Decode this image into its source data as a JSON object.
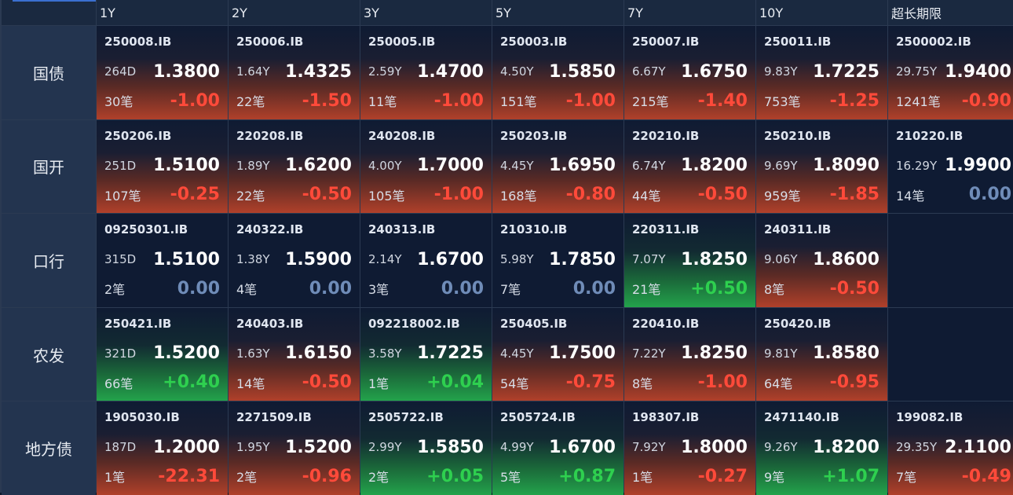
{
  "headers": [
    "1Y",
    "2Y",
    "3Y",
    "5Y",
    "7Y",
    "10Y",
    "超长期限"
  ],
  "rows": [
    {
      "label": "国债",
      "cells": [
        {
          "code": "250008.IB",
          "term": "264D",
          "yield": "1.3800",
          "count": "30笔",
          "change": "-1.00",
          "dir": "down"
        },
        {
          "code": "250006.IB",
          "term": "1.64Y",
          "yield": "1.4325",
          "count": "22笔",
          "change": "-1.50",
          "dir": "down"
        },
        {
          "code": "250005.IB",
          "term": "2.59Y",
          "yield": "1.4700",
          "count": "11笔",
          "change": "-1.00",
          "dir": "down"
        },
        {
          "code": "250003.IB",
          "term": "4.50Y",
          "yield": "1.5850",
          "count": "151笔",
          "change": "-1.00",
          "dir": "down"
        },
        {
          "code": "250007.IB",
          "term": "6.67Y",
          "yield": "1.6750",
          "count": "215笔",
          "change": "-1.40",
          "dir": "down"
        },
        {
          "code": "250011.IB",
          "term": "9.83Y",
          "yield": "1.7225",
          "count": "753笔",
          "change": "-1.25",
          "dir": "down"
        },
        {
          "code": "2500002.IB",
          "term": "29.75Y",
          "yield": "1.9400",
          "count": "1241笔",
          "change": "-0.90",
          "dir": "down"
        }
      ]
    },
    {
      "label": "国开",
      "cells": [
        {
          "code": "250206.IB",
          "term": "251D",
          "yield": "1.5100",
          "count": "107笔",
          "change": "-0.25",
          "dir": "down"
        },
        {
          "code": "220208.IB",
          "term": "1.89Y",
          "yield": "1.6200",
          "count": "22笔",
          "change": "-0.50",
          "dir": "down"
        },
        {
          "code": "240208.IB",
          "term": "4.00Y",
          "yield": "1.7000",
          "count": "105笔",
          "change": "-1.00",
          "dir": "down"
        },
        {
          "code": "250203.IB",
          "term": "4.45Y",
          "yield": "1.6950",
          "count": "168笔",
          "change": "-0.80",
          "dir": "down"
        },
        {
          "code": "220210.IB",
          "term": "6.74Y",
          "yield": "1.8200",
          "count": "44笔",
          "change": "-0.50",
          "dir": "down"
        },
        {
          "code": "250210.IB",
          "term": "9.69Y",
          "yield": "1.8090",
          "count": "959笔",
          "change": "-1.85",
          "dir": "down"
        },
        {
          "code": "210220.IB",
          "term": "16.29Y",
          "yield": "1.9900",
          "count": "14笔",
          "change": "0.00",
          "dir": "flat"
        }
      ]
    },
    {
      "label": "口行",
      "cells": [
        {
          "code": "09250301.IB",
          "term": "315D",
          "yield": "1.5100",
          "count": "2笔",
          "change": "0.00",
          "dir": "flat"
        },
        {
          "code": "240322.IB",
          "term": "1.38Y",
          "yield": "1.5900",
          "count": "4笔",
          "change": "0.00",
          "dir": "flat"
        },
        {
          "code": "240313.IB",
          "term": "2.14Y",
          "yield": "1.6700",
          "count": "3笔",
          "change": "0.00",
          "dir": "flat"
        },
        {
          "code": "210310.IB",
          "term": "5.98Y",
          "yield": "1.7850",
          "count": "7笔",
          "change": "0.00",
          "dir": "flat"
        },
        {
          "code": "220311.IB",
          "term": "7.07Y",
          "yield": "1.8250",
          "count": "21笔",
          "change": "+0.50",
          "dir": "up"
        },
        {
          "code": "240311.IB",
          "term": "9.06Y",
          "yield": "1.8600",
          "count": "8笔",
          "change": "-0.50",
          "dir": "down"
        },
        null
      ]
    },
    {
      "label": "农发",
      "cells": [
        {
          "code": "250421.IB",
          "term": "321D",
          "yield": "1.5200",
          "count": "66笔",
          "change": "+0.40",
          "dir": "up"
        },
        {
          "code": "240403.IB",
          "term": "1.63Y",
          "yield": "1.6150",
          "count": "14笔",
          "change": "-0.50",
          "dir": "down"
        },
        {
          "code": "092218002.IB",
          "term": "3.58Y",
          "yield": "1.7225",
          "count": "1笔",
          "change": "+0.04",
          "dir": "up"
        },
        {
          "code": "250405.IB",
          "term": "4.45Y",
          "yield": "1.7500",
          "count": "54笔",
          "change": "-0.75",
          "dir": "down"
        },
        {
          "code": "220410.IB",
          "term": "7.22Y",
          "yield": "1.8250",
          "count": "8笔",
          "change": "-1.00",
          "dir": "down"
        },
        {
          "code": "250420.IB",
          "term": "9.81Y",
          "yield": "1.8580",
          "count": "64笔",
          "change": "-0.95",
          "dir": "down"
        },
        null
      ]
    },
    {
      "label": "地方债",
      "cells": [
        {
          "code": "1905030.IB",
          "term": "187D",
          "yield": "1.2000",
          "count": "1笔",
          "change": "-22.31",
          "dir": "down"
        },
        {
          "code": "2271509.IB",
          "term": "1.95Y",
          "yield": "1.5200",
          "count": "2笔",
          "change": "-0.96",
          "dir": "down"
        },
        {
          "code": "2505722.IB",
          "term": "2.99Y",
          "yield": "1.5850",
          "count": "2笔",
          "change": "+0.05",
          "dir": "up"
        },
        {
          "code": "2505724.IB",
          "term": "4.99Y",
          "yield": "1.6700",
          "count": "5笔",
          "change": "+0.87",
          "dir": "up"
        },
        {
          "code": "198307.IB",
          "term": "7.92Y",
          "yield": "1.8000",
          "count": "1笔",
          "change": "-0.27",
          "dir": "down"
        },
        {
          "code": "2471140.IB",
          "term": "9.26Y",
          "yield": "1.8200",
          "count": "9笔",
          "change": "+1.07",
          "dir": "up"
        },
        {
          "code": "199082.IB",
          "term": "29.35Y",
          "yield": "2.1100",
          "count": "7笔",
          "change": "-0.49",
          "dir": "down"
        }
      ]
    }
  ]
}
